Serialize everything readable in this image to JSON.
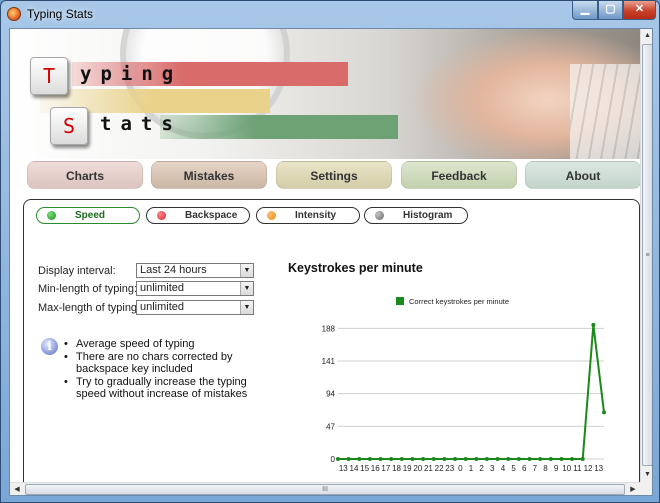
{
  "window": {
    "title": "Typing Stats",
    "buttons": {
      "minimize": "▁",
      "maximize": "▢",
      "close": "✕"
    }
  },
  "banner": {
    "logo_key_1": "T",
    "logo_word_1": "yping",
    "logo_key_2": "S",
    "logo_word_2": "tats"
  },
  "tabs": [
    {
      "label": "Charts"
    },
    {
      "label": "Mistakes"
    },
    {
      "label": "Settings"
    },
    {
      "label": "Feedback"
    },
    {
      "label": "About"
    }
  ],
  "subtabs": [
    {
      "label": "Speed",
      "color": "#1a8a1a",
      "active": true
    },
    {
      "label": "Backspace",
      "color": "#d42020",
      "active": false
    },
    {
      "label": "Intensity",
      "color": "#f08a10",
      "active": false
    },
    {
      "label": "Histogram",
      "color": "#777777",
      "active": false
    }
  ],
  "form": {
    "display_interval": {
      "label": "Display interval:",
      "value": "Last 24 hours"
    },
    "min_length": {
      "label": "Min-length of typing:",
      "value": "unlimited"
    },
    "max_length": {
      "label": "Max-length of typing:",
      "value": "unlimited"
    }
  },
  "tips": [
    "Average speed of typing",
    "There are no chars corrected by backspace key included",
    "Try to gradually increase the typing speed without increase of mistakes"
  ],
  "info_icon": "i",
  "chart_data": {
    "type": "line",
    "title": "Keystrokes per minute",
    "legend_position": "top",
    "series": [
      {
        "name": "Correct keystrokes per minute",
        "color": "#1a8a1a",
        "values": [
          0,
          0,
          0,
          0,
          0,
          0,
          0,
          0,
          0,
          0,
          0,
          0,
          0,
          0,
          0,
          0,
          0,
          0,
          0,
          0,
          0,
          0,
          0,
          0,
          193,
          67
        ]
      }
    ],
    "categories": [
      "13",
      "14",
      "15",
      "16",
      "17",
      "18",
      "19",
      "20",
      "21",
      "22",
      "23",
      "0",
      "1",
      "2",
      "3",
      "4",
      "5",
      "6",
      "7",
      "8",
      "9",
      "10",
      "11",
      "12",
      "13"
    ],
    "x_labels": [
      "13",
      "14",
      "15",
      "16",
      "17",
      "18",
      "19",
      "20",
      "21",
      "22",
      "23",
      "0",
      "1",
      "2",
      "3",
      "4",
      "5",
      "6",
      "7",
      "8",
      "9",
      "10",
      "11",
      "12",
      "13"
    ],
    "yticks": [
      0,
      47,
      94,
      141,
      188
    ],
    "ylim": [
      0,
      200
    ],
    "grid": true
  },
  "scrollbars": {
    "up": "▲",
    "down": "▼",
    "left": "◀",
    "right": "▶",
    "grip_v": "≡",
    "grip_h": "III"
  }
}
